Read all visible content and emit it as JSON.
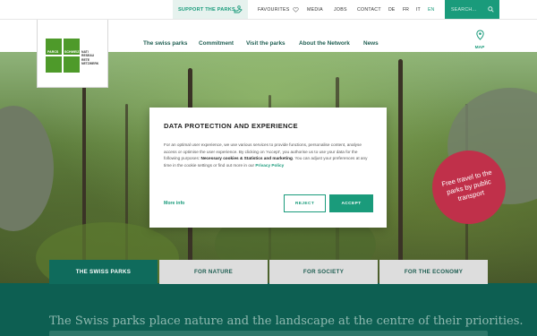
{
  "topbar": {
    "support": "SUPPORT THE PARKS",
    "favourites": "FAVOURITES",
    "media": "MEDIA",
    "jobs": "JOBS",
    "contact": "CONTACT",
    "languages": [
      "DE",
      "FR",
      "IT",
      "EN"
    ],
    "active_language": "EN",
    "search_placeholder": "SEARCH..."
  },
  "logo": {
    "mark_left": "PARCS",
    "mark_right": "SCHWEIZ",
    "words": [
      "NATI",
      "RESEAU",
      "RETE",
      "NETZWERK"
    ]
  },
  "nav": {
    "items": [
      "The swiss parks",
      "Commitment",
      "Visit the parks",
      "About the Network",
      "News"
    ],
    "map_label": "MAP"
  },
  "hero": {
    "badge_text": "Free travel to the parks by public transport"
  },
  "modal": {
    "title": "DATA PROTECTION AND EXPERIENCE",
    "body_1": "For an optimal user experience, we use various services to provide functions, personalise content, analyse access or optimise the user experience. By clicking on 'Accept', you authorise us to use your data for the following purposes: ",
    "body_bold": "Necessary cookies & Statistics and marketing",
    "body_2": ". You can adjust your preferences at any time in the cookie settings or find out more in our ",
    "privacy_link": "Privacy Policy",
    "more_info": "More info",
    "reject": "REJECT",
    "accept": "ACCEPT"
  },
  "tabs": [
    {
      "label": "THE SWISS PARKS",
      "active": true
    },
    {
      "label": "FOR NATURE",
      "active": false
    },
    {
      "label": "FOR SOCIETY",
      "active": false
    },
    {
      "label": "FOR THE ECONOMY",
      "active": false
    }
  ],
  "intro": {
    "headline": "The Swiss parks place nature and the landscape at the centre of their priorities."
  },
  "colors": {
    "accent": "#1a9b7b",
    "dark_teal": "#0d5f52",
    "badge": "#c0304a"
  }
}
